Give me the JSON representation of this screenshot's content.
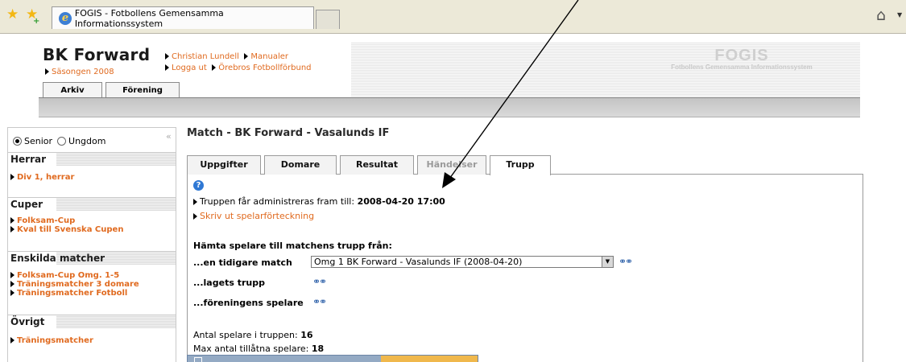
{
  "browser": {
    "tab_title": "FOGIS - Fotbollens Gemensamma Informationssystem"
  },
  "header": {
    "club_name": "BK Forward",
    "season": "Säsongen 2008",
    "links": {
      "user": "Christian Lundell",
      "manuals": "Manualer",
      "logout": "Logga ut",
      "federation": "Örebros Fotbollförbund"
    },
    "logo_big": "FOGIS",
    "logo_small": "Fotbollens Gemensamma Informationssystem",
    "tabs": [
      "Arkiv",
      "Förening"
    ]
  },
  "sidebar": {
    "radio_senior": "Senior",
    "radio_youth": "Ungdom",
    "collapse": "«",
    "sections": [
      {
        "title": "Herrar",
        "items": [
          "Div 1, herrar"
        ]
      },
      {
        "title": "Cuper",
        "items": [
          "Folksam-Cup",
          "Kval till Svenska Cupen"
        ]
      },
      {
        "title": "Enskilda matcher",
        "items": [
          "Folksam-Cup Omg. 1-5",
          "Träningsmatcher 3 domare",
          "Träningsmatcher Fotboll"
        ]
      },
      {
        "title": "Övrigt",
        "items": [
          "Träningsmatcher"
        ]
      }
    ]
  },
  "main": {
    "title": "Match - BK Forward - Vasalunds IF",
    "tabs": [
      "Uppgifter",
      "Domare",
      "Resultat",
      "Händelser",
      "Trupp"
    ],
    "active_tab": "Trupp",
    "disabled_tab": "Händelser",
    "admin_text": "Truppen får administreras fram till: ",
    "admin_deadline": "2008-04-20 17:00",
    "print_link": "Skriv ut spelarförteckning",
    "fetch_heading": "Hämta spelare till matchens trupp från:",
    "fetch_previous_label": "...en tidigare match",
    "fetch_previous_value": "Omg 1 BK Forward - Vasalunds IF (2008-04-20)",
    "fetch_team_label": "...lagets trupp",
    "fetch_club_label": "...föreningens spelare",
    "player_count_label": "Antal spelare i truppen: ",
    "player_count": "16",
    "max_players_label": "Max antal tillåtna spelare: ",
    "max_players": "18"
  },
  "colors": {
    "link_orange": "#e06a1f",
    "header_grey": "#c4c4c4",
    "table_header_blue": "#94aac4",
    "table_header_orange": "#f0b84c"
  }
}
